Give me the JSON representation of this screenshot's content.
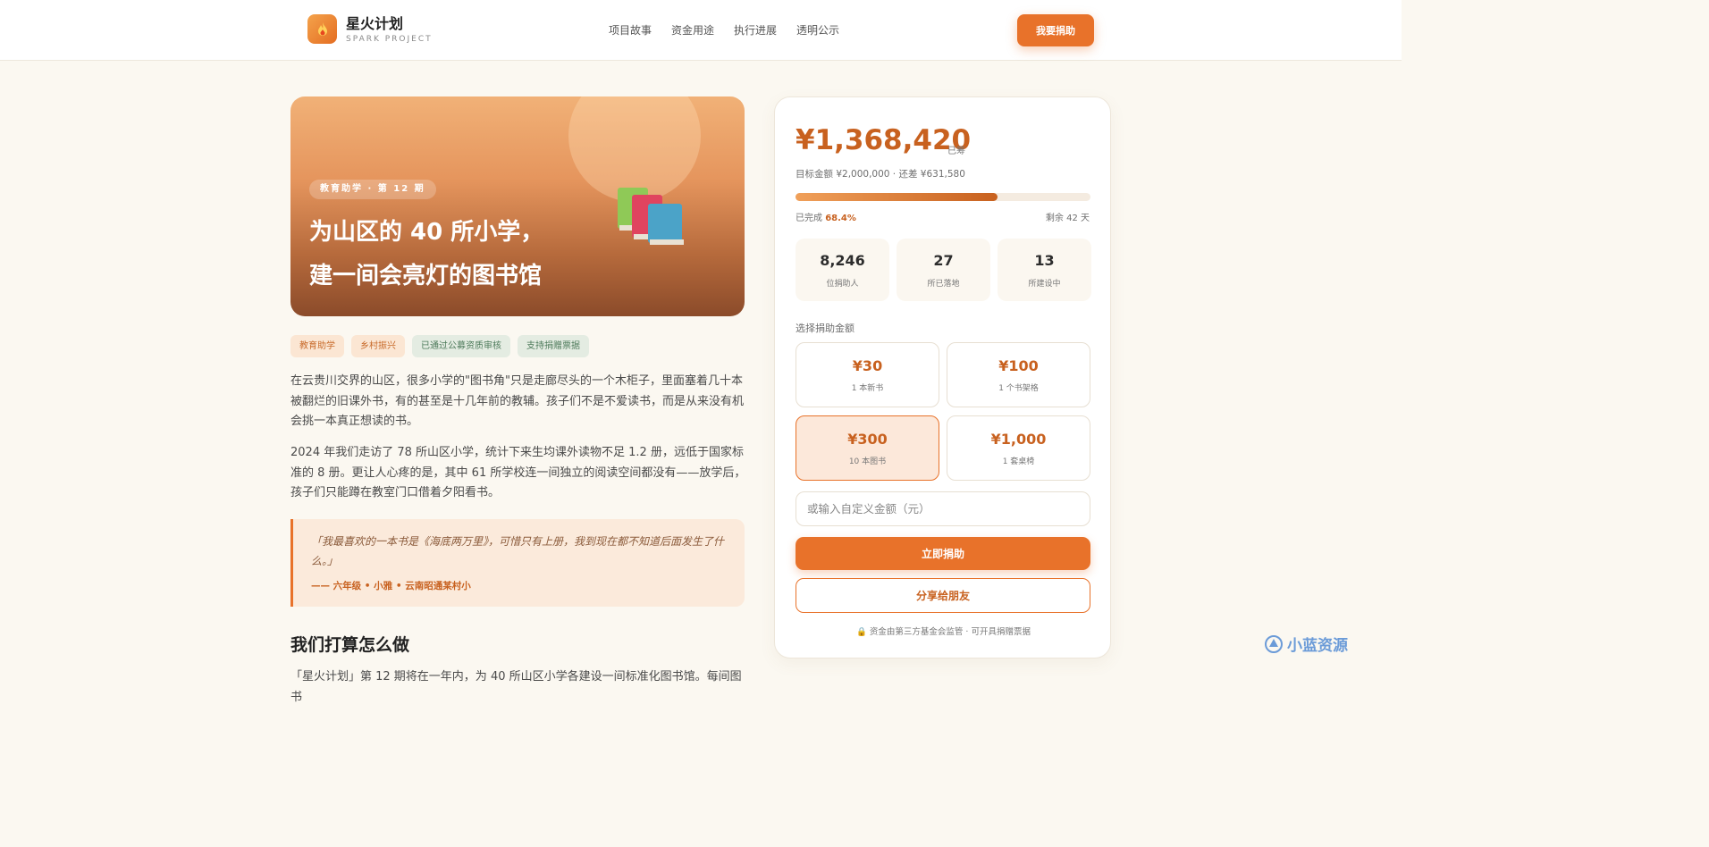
{
  "header": {
    "brand_name": "星火计划",
    "brand_sub": "SPARK PROJECT",
    "nav": [
      "项目故事",
      "资金用途",
      "执行进展",
      "透明公示"
    ],
    "donate_button": "我要捐助",
    "logo_icon": "flame-icon"
  },
  "hero": {
    "badge": "教育助学 · 第 12 期",
    "title_line1": "为山区的 40 所小学，",
    "title_line2": "建一间会亮灯的图书馆",
    "icon": "books-icon"
  },
  "tags": [
    "教育助学",
    "乡村振兴",
    "已通过公募资质审核",
    "支持捐赠票据"
  ],
  "story": {
    "para1": "在云贵川交界的山区，很多小学的\"图书角\"只是走廊尽头的一个木柜子，里面塞着几十本被翻烂的旧课外书，有的甚至是十几年前的教辅。孩子们不是不爱读书，而是从来没有机会挑一本真正想读的书。",
    "para2": "2024 年我们走访了 78 所山区小学，统计下来生均课外读物不足 1.2 册，远低于国家标准的 8 册。更让人心疼的是，其中 61 所学校连一间独立的阅读空间都没有——放学后，孩子们只能蹲在教室门口借着夕阳看书。",
    "quote": "「我最喜欢的一本书是《海底两万里》，可惜只有上册，我到现在都不知道后面发生了什么。」",
    "quote_author": "—— 六年级 • 小雅 • 云南昭通某村小",
    "section_title": "我们打算怎么做",
    "para3": "「星火计划」第 12 期将在一年内，为 40 所山区小学各建设一间标准化图书馆。每间图书"
  },
  "donate": {
    "raised": "¥1,368,420",
    "raised_unit": "已筹",
    "goal_line": "目标金额 ¥2,000,000 · 还差 ¥631,580",
    "progress_fraction": 0.684,
    "pct_label": "已完成",
    "pct_value": "68.4%",
    "days_left": "剩余 42 天",
    "stats": [
      {
        "num": "8,246",
        "label": "位捐助人"
      },
      {
        "num": "27",
        "label": "所已落地"
      },
      {
        "num": "13",
        "label": "所建设中"
      }
    ],
    "choose_label": "选择捐助金额",
    "amounts": [
      {
        "value": "¥30",
        "desc": "1 本新书",
        "selected": false
      },
      {
        "value": "¥100",
        "desc": "1 个书架格",
        "selected": false
      },
      {
        "value": "¥300",
        "desc": "10 本图书",
        "selected": true
      },
      {
        "value": "¥1,000",
        "desc": "1 套桌椅",
        "selected": false
      }
    ],
    "custom_placeholder": "或输入自定义金额（元）",
    "donate_now": "立即捐助",
    "share": "分享给朋友",
    "footnote": "资金由第三方基金会监管 · 可开具捐赠票据",
    "footnote_icon": "lock-icon"
  },
  "watermark": "小蓝资源",
  "colors": {
    "accent": "#e8722a",
    "accent_dark": "#c8611f",
    "background": "#fbf8f1"
  }
}
